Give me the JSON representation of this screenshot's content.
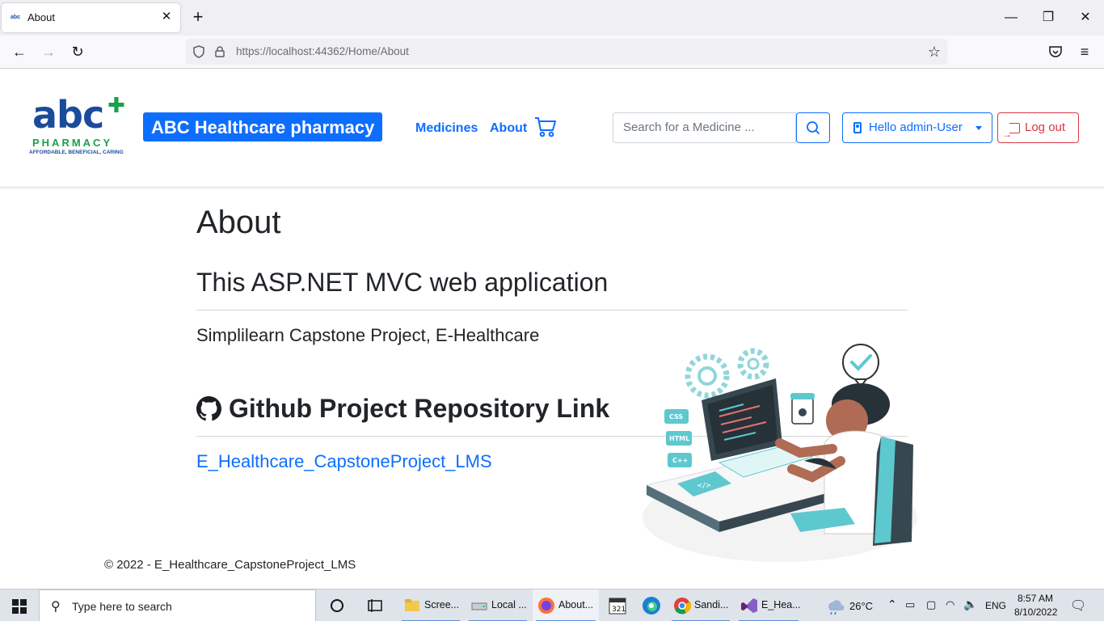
{
  "browser": {
    "tab_title": "About",
    "tab_favicon_text": "abc",
    "url_host": "https://localhost",
    "url_rest": ":44362/Home/About"
  },
  "header": {
    "logo_text": "abc",
    "logo_subtitle": "PHARMACY",
    "logo_tagline": "AFFORDABLE, BENEFICIAL, CARING",
    "brand": "ABC Healthcare pharmacy",
    "nav": {
      "medicines": "Medicines",
      "about": "About"
    },
    "search_placeholder": "Search for a Medicine ...",
    "user_button": "Hello admin-User",
    "logout_button": "Log out"
  },
  "main": {
    "title": "About",
    "app_heading": "This ASP.NET MVC web application",
    "description": "Simplilearn Capstone Project, E-Healthcare",
    "github_heading": "Github Project Repository Link",
    "repo_link": "E_Healthcare_CapstoneProject_LMS",
    "illustration_labels": [
      "CSS",
      "HTML",
      "C++"
    ]
  },
  "footer": {
    "text": "© 2022 - E_Healthcare_CapstoneProject_LMS"
  },
  "taskbar": {
    "search_placeholder": "Type here to search",
    "apps": [
      {
        "label": "Scree...",
        "icon": "folder-icon"
      },
      {
        "label": "Local ...",
        "icon": "drive-icon"
      },
      {
        "label": "About...",
        "icon": "firefox-icon"
      },
      {
        "label": "Sandi...",
        "icon": "chrome-icon"
      },
      {
        "label": "E_Hea...",
        "icon": "visual-studio-icon"
      }
    ],
    "weather": "26°C",
    "language": "ENG",
    "time": "8:57 AM",
    "date": "8/10/2022"
  },
  "colors": {
    "primary": "#0d6efd",
    "danger": "#dc3545",
    "logo_blue": "#1b4b9b",
    "logo_green": "#19a04b",
    "illustration_teal": "#5ec8cf"
  }
}
